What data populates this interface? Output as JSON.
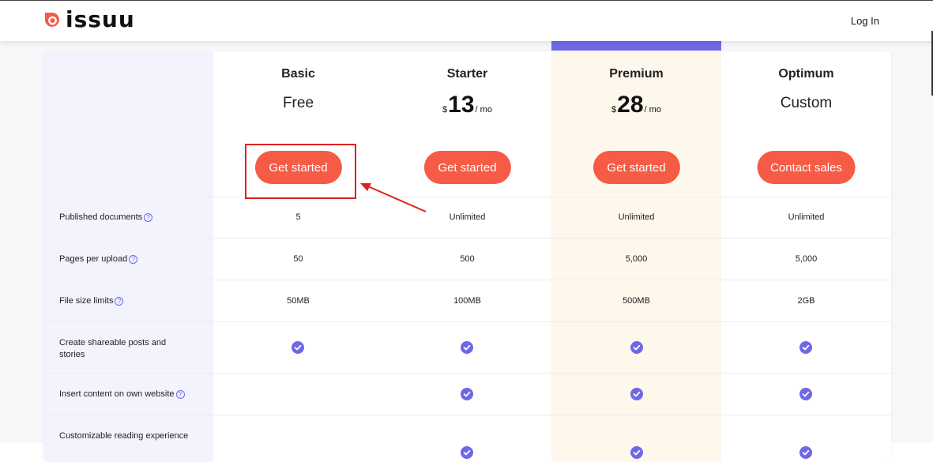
{
  "header": {
    "logo_text": "issuu",
    "login_label": "Log In",
    "brand_color": "#f55b45"
  },
  "plans": [
    {
      "name": "Basic",
      "price_text": "Free",
      "cta": "Get started"
    },
    {
      "name": "Starter",
      "currency": "$",
      "amount": "13",
      "period": "/ mo",
      "cta": "Get started"
    },
    {
      "name": "Premium",
      "currency": "$",
      "amount": "28",
      "period": "/ mo",
      "cta": "Get started",
      "highlighted": true
    },
    {
      "name": "Optimum",
      "price_text": "Custom",
      "cta": "Contact sales"
    }
  ],
  "features": [
    {
      "label": "Published documents",
      "help": true,
      "values": [
        "5",
        "Unlimited",
        "Unlimited",
        "Unlimited"
      ]
    },
    {
      "label": "Pages per upload",
      "help": true,
      "values": [
        "50",
        "500",
        "5,000",
        "5,000"
      ]
    },
    {
      "label": "File size limits",
      "help": true,
      "values": [
        "50MB",
        "100MB",
        "500MB",
        "2GB"
      ]
    },
    {
      "label": "Create shareable posts and stories",
      "help": false,
      "checks": [
        true,
        true,
        true,
        true
      ]
    },
    {
      "label": "Insert content on own website",
      "help": true,
      "checks": [
        false,
        true,
        true,
        true
      ]
    },
    {
      "label": "Customizable reading experience",
      "help": false,
      "checks": [
        false,
        true,
        true,
        true
      ]
    }
  ],
  "colors": {
    "accent": "#6f68e6",
    "cta": "#f55b45",
    "premium_bg": "#fdf7ec",
    "label_bg": "#f3f3fd",
    "annotation": "#e02020"
  },
  "icons": {
    "logo": "issuu-logo-icon",
    "help": "help-circle-icon",
    "check": "check-circle-icon"
  }
}
